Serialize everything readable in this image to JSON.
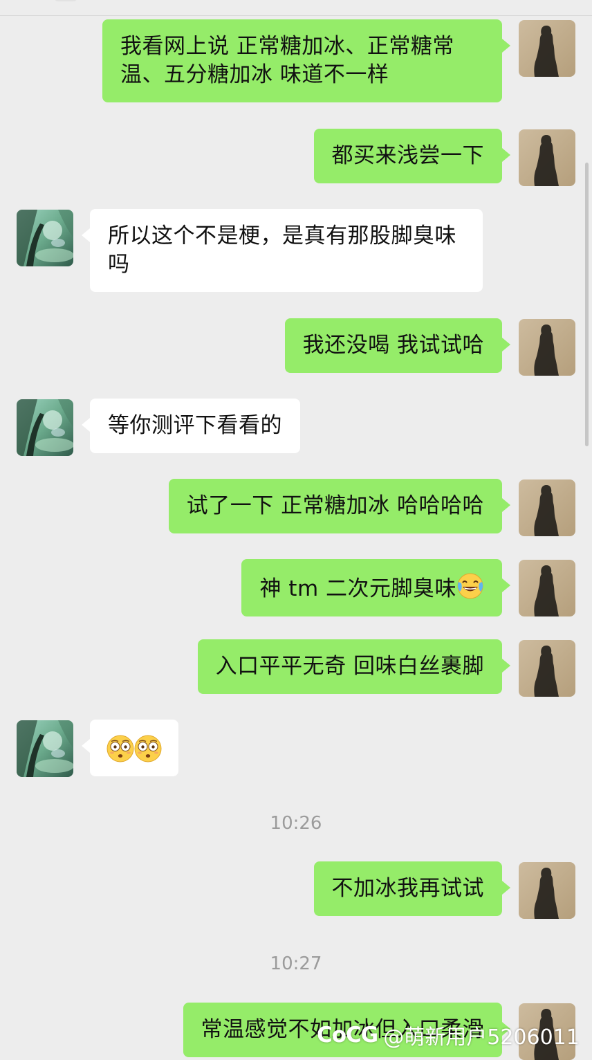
{
  "messages": [
    {
      "side": "me",
      "text": "我看网上说 正常糖加冰、正常糖常温、五分糖加冰 味道不一样"
    },
    {
      "side": "me",
      "text": "都买来浅尝一下"
    },
    {
      "side": "peer",
      "text": "所以这个不是梗，是真有那股脚臭味吗"
    },
    {
      "side": "me",
      "text": "我还没喝 我试试哈"
    },
    {
      "side": "peer",
      "text": "等你测评下看看的"
    },
    {
      "side": "me",
      "text": "试了一下 正常糖加冰 哈哈哈哈"
    },
    {
      "side": "me",
      "text": "神 tm 二次元脚臭味"
    },
    {
      "side": "me",
      "text": "入口平平无奇 回味白丝裹脚"
    },
    {
      "side": "peer",
      "emoji": "flushed-face-emoji x2"
    },
    {
      "time": "10:26"
    },
    {
      "side": "me",
      "text": "不加冰我再试试"
    },
    {
      "time": "10:27"
    },
    {
      "side": "me",
      "text": "常温感觉不如加冰但入口柔滑"
    }
  ],
  "emojis": {
    "laugh": "tears-of-joy-emoji",
    "flushed": "flushed-face-emoji"
  },
  "watermark": {
    "logo": "CoCG",
    "text": "@萌新用户5206011"
  },
  "colors": {
    "background": "#ededed",
    "my_bubble": "#95ec69",
    "peer_bubble": "#ffffff",
    "time_text": "#9b9b9b"
  }
}
